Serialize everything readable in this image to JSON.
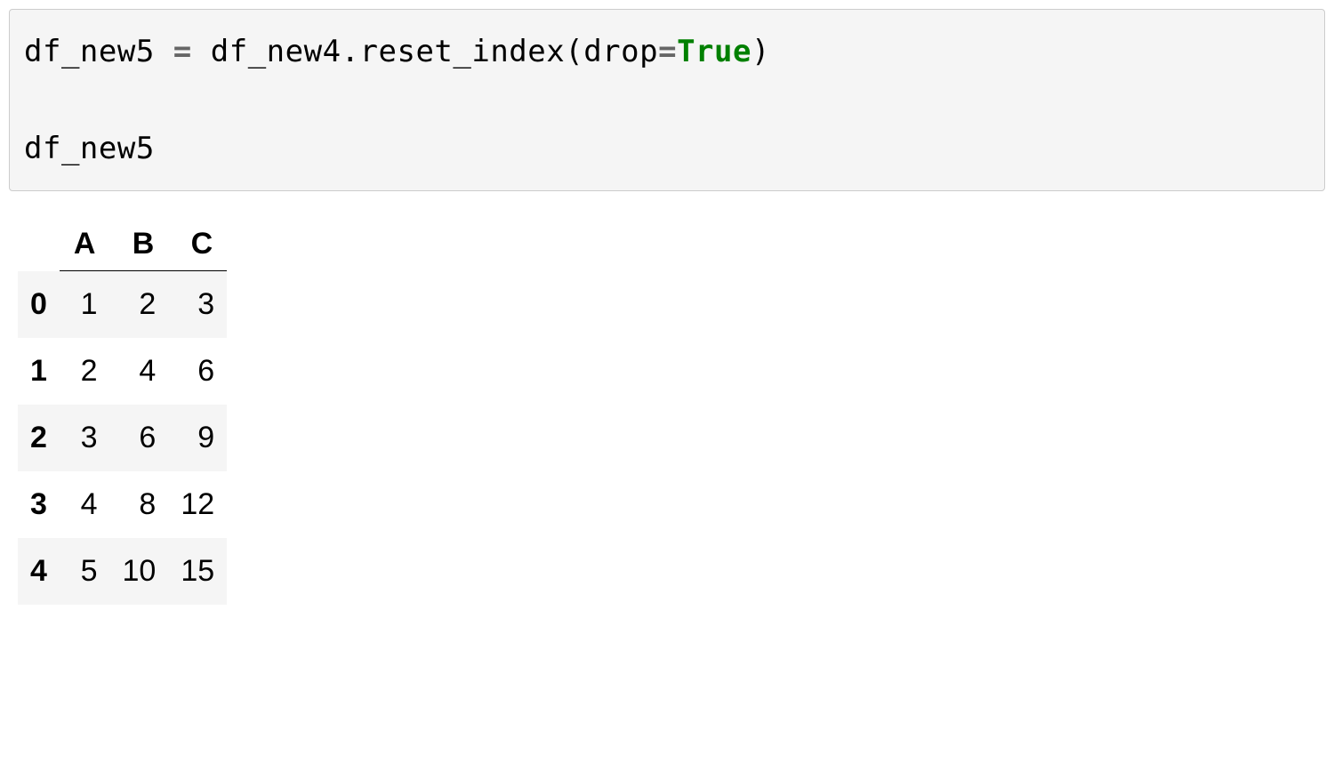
{
  "code": {
    "line1": {
      "var1": "df_new5",
      "sp1": " ",
      "assign": "=",
      "sp2": " ",
      "var2": "df_new4",
      "dot": ".",
      "fn": "reset_index",
      "lparen": "(",
      "kwarg": "drop",
      "eq": "=",
      "true": "True",
      "rparen": ")"
    },
    "line2": "",
    "line3": "df_new5"
  },
  "table": {
    "index_header": "",
    "columns": [
      "A",
      "B",
      "C"
    ],
    "rows": [
      {
        "idx": "0",
        "cells": [
          "1",
          "2",
          "3"
        ]
      },
      {
        "idx": "1",
        "cells": [
          "2",
          "4",
          "6"
        ]
      },
      {
        "idx": "2",
        "cells": [
          "3",
          "6",
          "9"
        ]
      },
      {
        "idx": "3",
        "cells": [
          "4",
          "8",
          "12"
        ]
      },
      {
        "idx": "4",
        "cells": [
          "5",
          "10",
          "15"
        ]
      }
    ]
  }
}
